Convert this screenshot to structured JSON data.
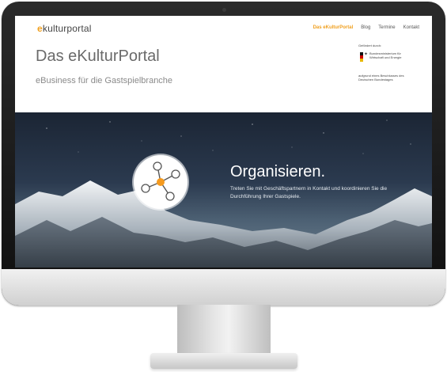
{
  "site": {
    "logo_prefix": "e",
    "logo_rest": "kulturportal",
    "nav": [
      "Das eKulturPortal",
      "Blog",
      "Termine",
      "Kontakt"
    ],
    "title": "Das eKulturPortal",
    "subtitle": "eBusiness für die Gastspielbranche"
  },
  "sponsor": {
    "top_text": "Gefördert durch:",
    "ministry": "Bundesministerium für Wirtschaft und Energie",
    "bottom_text": "aufgrund eines Beschlusses des Deutschen Bundestages"
  },
  "banner": {
    "headline": "Organisieren.",
    "description": "Treten Sie mit Geschäftspartnern in Kontakt und koordinieren Sie die Durchführung Ihrer Gastspiele."
  },
  "colors": {
    "accent": "#f0a020",
    "network_node": "#f59a1e"
  },
  "icons": {
    "network": "network-hub-icon",
    "flag": "german-flag-icon",
    "eagle": "federal-eagle-icon"
  }
}
